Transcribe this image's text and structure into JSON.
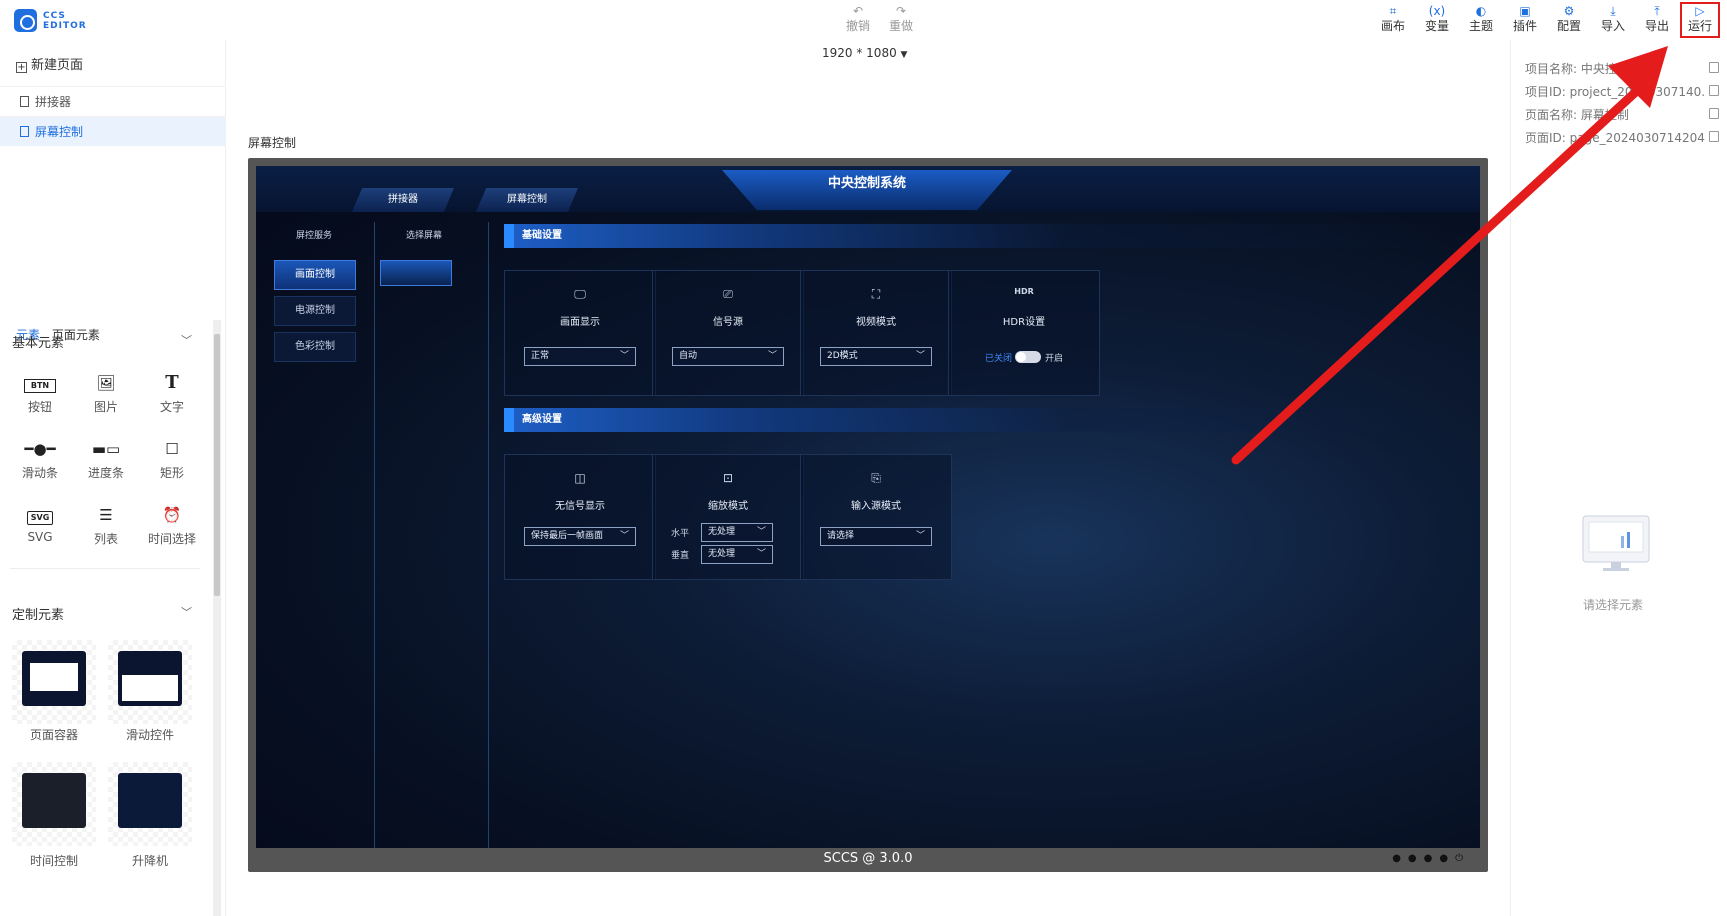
{
  "app": {
    "logo_line1": "CCS",
    "logo_line2": "EDITOR"
  },
  "toolbar": {
    "undo": "撤销",
    "redo": "重做",
    "canvas": "画布",
    "variables": "变量",
    "theme": "主题",
    "plugins": "插件",
    "config": "配置",
    "import": "导入",
    "export": "导出",
    "run": "运行"
  },
  "left": {
    "new_page": "新建页面",
    "pages": [
      "拼接器",
      "屏幕控制"
    ],
    "tabs": [
      "元素",
      "页面元素"
    ],
    "basic_title": "基本元素",
    "basic_items": [
      "按钮",
      "图片",
      "文字",
      "滑动条",
      "进度条",
      "矩形",
      "SVG",
      "列表",
      "时间选择"
    ],
    "btn_icon_text": "BTN",
    "svg_icon_text": "SVG",
    "custom_title": "定制元素",
    "custom_items": [
      "页面容器",
      "滑动控件",
      "时间控制",
      "升降机"
    ]
  },
  "canvas": {
    "resolution": "1920 * 1080",
    "page_label": "屏幕控制",
    "footer": "SCCS @ 3.0.0"
  },
  "screen": {
    "title": "中央控制系统",
    "tabs": [
      "拼接器",
      "屏幕控制"
    ],
    "col1_label": "屏控服务",
    "col2_label": "选择屏幕",
    "side_buttons": [
      "画面控制",
      "电源控制",
      "色彩控制"
    ],
    "basic_section": "基础设置",
    "advanced_section": "高级设置",
    "cards": [
      {
        "title": "画面显示",
        "value": "正常"
      },
      {
        "title": "信号源",
        "value": "自动"
      },
      {
        "title": "视频模式",
        "value": "2D模式"
      },
      {
        "title": "HDR设置",
        "off": "已关闭",
        "on": "开启",
        "icon_text": "HDR"
      }
    ],
    "adv_cards": [
      {
        "title": "无信号显示",
        "value": "保持最后一帧画面"
      },
      {
        "title": "缩放模式",
        "h_label": "水平",
        "h_value": "无处理",
        "v_label": "垂直",
        "v_value": "无处理"
      },
      {
        "title": "输入源模式",
        "value": "请选择"
      }
    ]
  },
  "right": {
    "project_name": "项目名称: 中央控制系统",
    "project_id": "项目ID: project_20240307140...",
    "page_name": "页面名称: 屏幕控制",
    "page_id": "页面ID: page_20240307142044...",
    "empty": "请选择元素"
  },
  "colors": {
    "accent": "#1f6fde",
    "highlight": "#e51c1c"
  }
}
